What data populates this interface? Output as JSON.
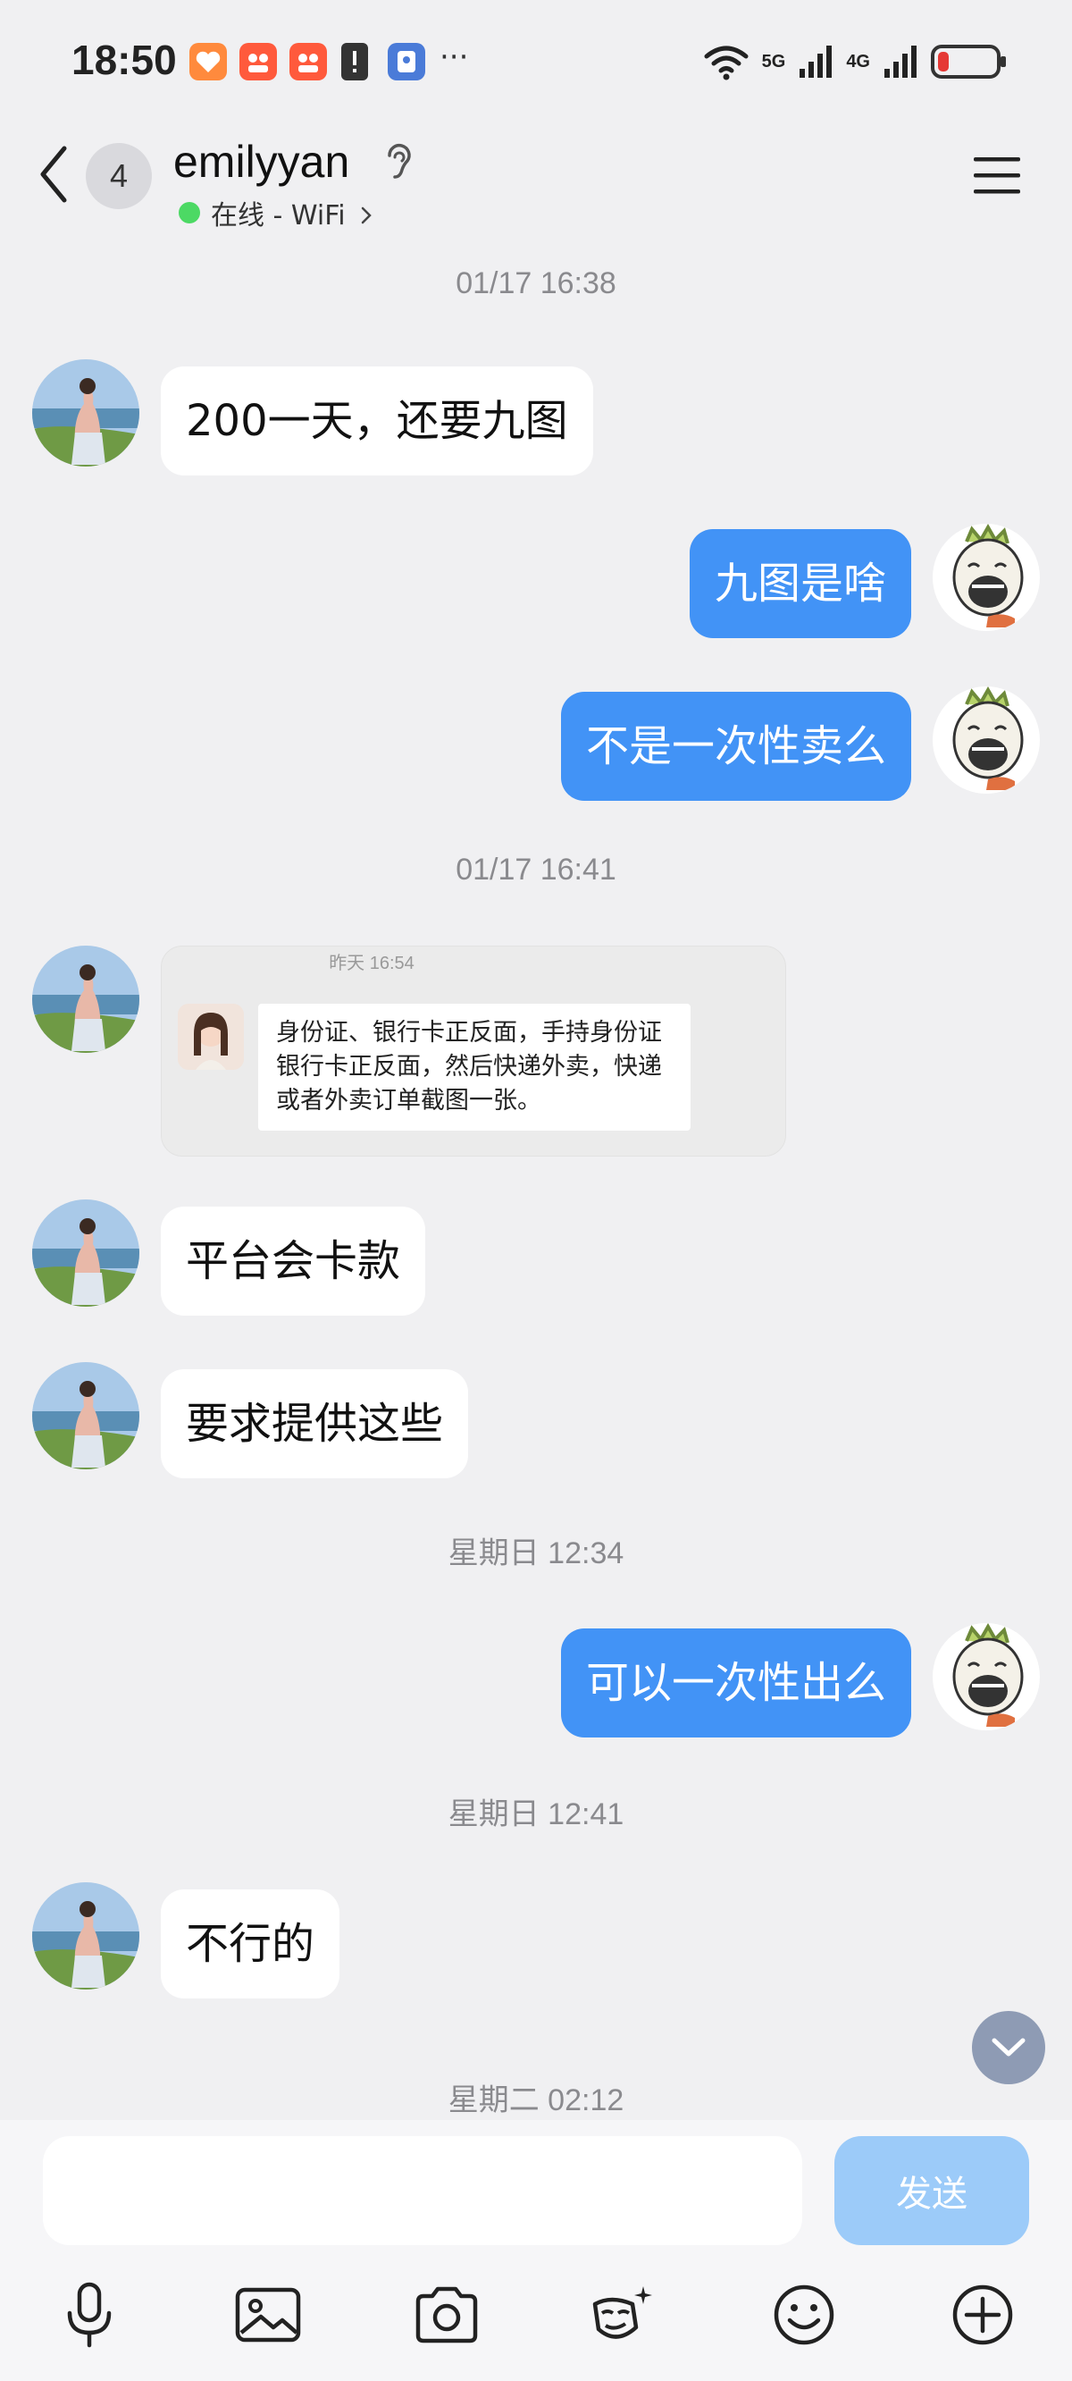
{
  "status_bar": {
    "time": "18:50",
    "signal_1": "5G",
    "signal_2": "4G",
    "more": "···"
  },
  "header": {
    "unread_count": "4",
    "contact_name": "emilyyan",
    "online_status": "在线 - WiFi"
  },
  "messages": {
    "ts1": "01/17 16:38",
    "m1": "200一天，还要九图",
    "m2": "九图是啥",
    "m3": "不是一次性卖么",
    "ts2": "01/17 16:41",
    "quote": {
      "time": "昨天 16:54",
      "text": "身份证、银行卡正反面，手持身份证银行卡正反面，然后快递外卖，快递或者外卖订单截图一张。"
    },
    "m4": "平台会卡款",
    "m5": "要求提供这些",
    "ts3": "星期日 12:34",
    "m6": "可以一次性出么",
    "ts4": "星期日 12:41",
    "m7": "不行的",
    "ts5": "星期二 02:12"
  },
  "input": {
    "value": "",
    "placeholder": "",
    "send_label": "发送"
  },
  "toolbar": [
    "mic-icon",
    "image-icon",
    "camera-icon",
    "sticker-icon",
    "emoji-icon",
    "plus-icon"
  ],
  "colors": {
    "outgoing_bubble": "#4293f6",
    "incoming_bubble": "#ffffff",
    "send_button_disabled": "#9ccbf9",
    "online": "#4cd964"
  }
}
